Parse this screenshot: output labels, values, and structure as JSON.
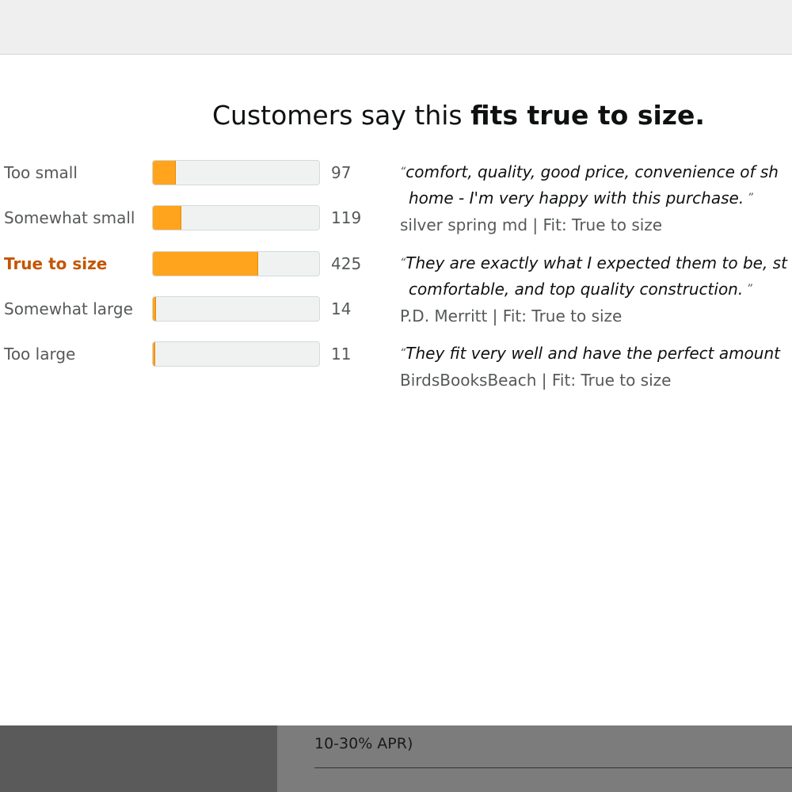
{
  "headline": {
    "prefix": "Customers say this ",
    "emphasis": "fits true to size."
  },
  "fit_rows": [
    {
      "label": "Too small",
      "count": "97",
      "fraction": 0.138
    },
    {
      "label": "Somewhat small",
      "count": "119",
      "fraction": 0.172
    },
    {
      "label": "True to size",
      "count": "425",
      "fraction": 0.635,
      "active": true
    },
    {
      "label": "Somewhat large",
      "count": "14",
      "fraction": 0.02
    },
    {
      "label": "Too large",
      "count": "11",
      "fraction": 0.015
    }
  ],
  "quotes": [
    {
      "line1": "comfort, quality, good price, convenience of sh",
      "line2": "home - I'm very happy with this purchase.",
      "author": "silver spring md | Fit: True to size"
    },
    {
      "line1": "They are exactly what I expected them to be, st",
      "line2": "comfortable, and top quality construction.",
      "author": "P.D. Merritt | Fit: True to size"
    },
    {
      "line1": "They fit very well and have the perfect amount",
      "line2": "",
      "author": "BirdsBooksBeach | Fit: True to size"
    }
  ],
  "background": {
    "apr_text": "10-30% APR)"
  },
  "colors": {
    "bar_fill": "#ffa41c",
    "active_label": "#c45500",
    "track": "#f0f2f2"
  }
}
